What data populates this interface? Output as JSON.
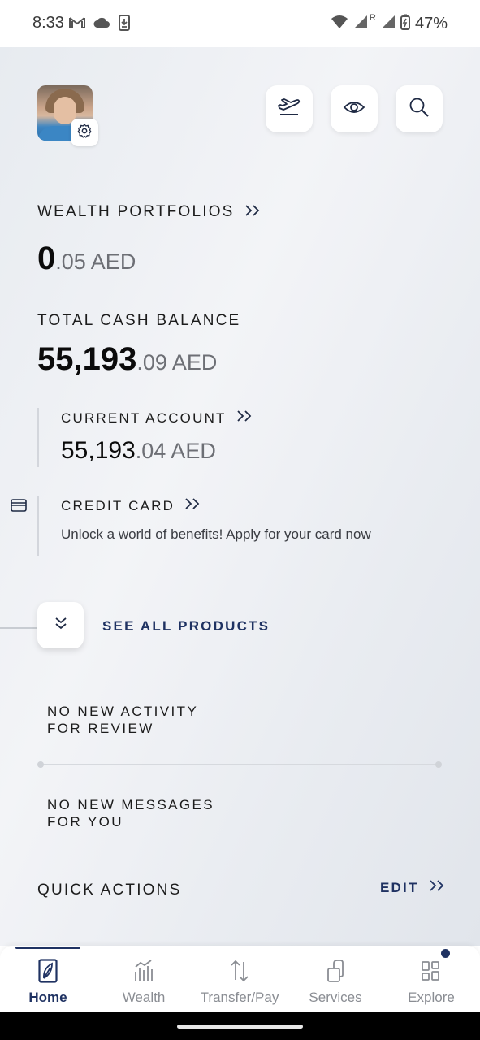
{
  "status_bar": {
    "time": "8:33",
    "battery": "47%",
    "network_indicator": "R"
  },
  "header": {
    "avatar_icon": "profile-photo",
    "settings_icon": "gear-icon",
    "buttons": [
      {
        "name": "travel-mode",
        "icon": "airplane-takeoff-icon"
      },
      {
        "name": "visibility",
        "icon": "eye-icon"
      },
      {
        "name": "search",
        "icon": "search-icon"
      }
    ]
  },
  "wealth": {
    "label": "WEALTH PORTFOLIOS",
    "amount_int": "0",
    "amount_dec": ".05 AED"
  },
  "cash": {
    "label": "TOTAL CASH BALANCE",
    "amount_int": "55,193",
    "amount_dec": ".09 AED"
  },
  "current_account": {
    "label": "CURRENT ACCOUNT",
    "amount_int": "55,193",
    "amount_dec": ".04 AED"
  },
  "credit_card": {
    "label": "CREDIT CARD",
    "description": "Unlock a world of benefits! Apply for your card now"
  },
  "see_all": {
    "label": "SEE ALL PRODUCTS"
  },
  "activity": {
    "line1": "NO NEW ACTIVITY",
    "line2": "FOR REVIEW"
  },
  "messages": {
    "line1": "NO NEW MESSAGES",
    "line2": "FOR YOU"
  },
  "quick_actions": {
    "label": "QUICK ACTIONS",
    "edit_label": "EDIT"
  },
  "bottom_nav": [
    {
      "label": "Home",
      "icon": "home-leaf-icon",
      "active": true
    },
    {
      "label": "Wealth",
      "icon": "bar-chart-icon",
      "active": false
    },
    {
      "label": "Transfer/Pay",
      "icon": "transfer-arrows-icon",
      "active": false
    },
    {
      "label": "Services",
      "icon": "services-icon",
      "active": false
    },
    {
      "label": "Explore",
      "icon": "explore-grid-icon",
      "active": false,
      "badge": true
    }
  ],
  "colors": {
    "accent": "#1f3262",
    "background_start": "#e7ebf0",
    "background_end": "#e1e5eb",
    "muted_text": "#6d6f75"
  }
}
